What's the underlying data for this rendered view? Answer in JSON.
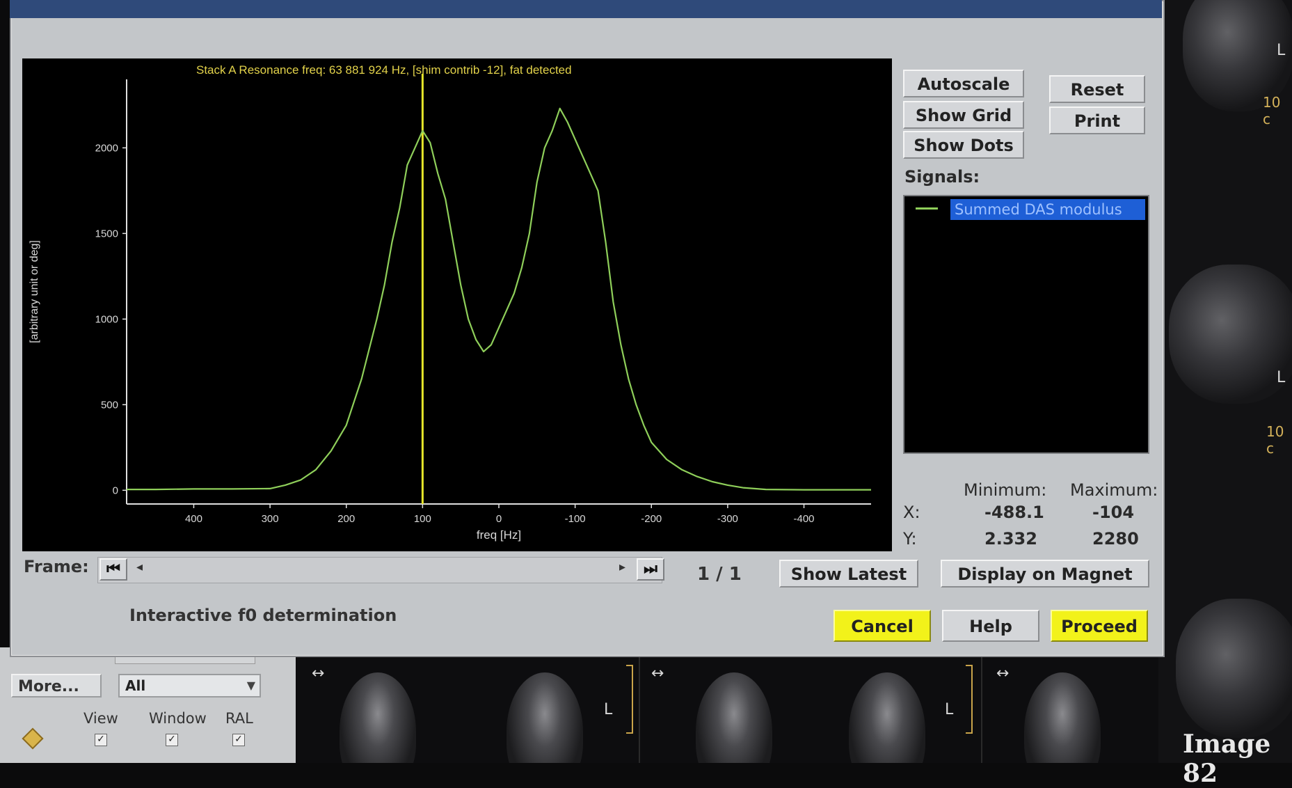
{
  "chart_data": {
    "type": "line",
    "title": "Stack A Resonance freq: 63 881 924 Hz, [shim contrib -12], fat detected",
    "xlabel": "freq [Hz]",
    "ylabel": "[arbitrary unit or deg]",
    "x_reversed": true,
    "xlim": [
      488,
      -488
    ],
    "ylim": [
      -80,
      2400
    ],
    "x_ticks": [
      400,
      300,
      200,
      100,
      0,
      -100,
      -200,
      -300,
      -400
    ],
    "x_tick_labels": [
      "400",
      "300",
      "200",
      "100",
      "0",
      "-100",
      "-200",
      "-300",
      "-400"
    ],
    "y_ticks": [
      0,
      500,
      1000,
      1500,
      2000
    ],
    "y_tick_labels": [
      "0",
      "500",
      "1000",
      "1500",
      "2000"
    ],
    "marker_x": 100,
    "marker_color": "#e6e62a",
    "series": [
      {
        "name": "Summed DAS modulus",
        "color": "#8fcf5a",
        "x": [
          488,
          450,
          400,
          350,
          300,
          280,
          260,
          240,
          220,
          200,
          180,
          160,
          150,
          140,
          130,
          120,
          110,
          100,
          90,
          80,
          70,
          60,
          50,
          40,
          30,
          20,
          10,
          0,
          -10,
          -20,
          -30,
          -40,
          -50,
          -60,
          -70,
          -80,
          -90,
          -100,
          -110,
          -120,
          -130,
          -140,
          -150,
          -160,
          -170,
          -180,
          -190,
          -200,
          -220,
          -240,
          -260,
          -280,
          -300,
          -320,
          -350,
          -400,
          -450,
          -488
        ],
        "y": [
          5,
          5,
          8,
          8,
          10,
          30,
          60,
          120,
          230,
          380,
          650,
          1000,
          1200,
          1450,
          1650,
          1900,
          2000,
          2100,
          2030,
          1850,
          1700,
          1450,
          1200,
          1000,
          880,
          810,
          850,
          950,
          1050,
          1150,
          1300,
          1500,
          1800,
          2000,
          2100,
          2230,
          2150,
          2050,
          1950,
          1850,
          1750,
          1450,
          1100,
          850,
          650,
          500,
          380,
          280,
          180,
          120,
          80,
          50,
          30,
          15,
          5,
          3,
          3,
          3
        ]
      }
    ]
  },
  "controls": {
    "autoscale": "Autoscale",
    "show_grid": "Show Grid",
    "show_dots": "Show Dots",
    "reset": "Reset",
    "print": "Print",
    "signals_label": "Signals:",
    "signal_item": "Summed DAS modulus"
  },
  "stats": {
    "min_header": "Minimum:",
    "max_header": "Maximum:",
    "x_label": "X:",
    "y_label": "Y:",
    "x_min": "-488.1",
    "x_max": "-104",
    "y_min": "2.332",
    "y_max": "2280"
  },
  "frame": {
    "label": "Frame:",
    "count": "1 / 1",
    "show_latest": "Show Latest",
    "display_on_magnet": "Display on Magnet"
  },
  "footer": {
    "status": "Interactive f0 determination",
    "cancel": "Cancel",
    "help": "Help",
    "proceed": "Proceed"
  },
  "viewer": {
    "more": "More...",
    "filter_value": "All",
    "view_label": "View",
    "window_label": "Window",
    "ral_label": "RAL",
    "image_label": "Image 82",
    "ruler_label": "10 c",
    "ruler_label2": "10 c",
    "orient_l": "L",
    "arrow_glyph": "↔"
  },
  "colors": {
    "accent_yellow": "#f2f21a",
    "selection_blue": "#1e5fd6",
    "trace_green": "#8fcf5a"
  }
}
